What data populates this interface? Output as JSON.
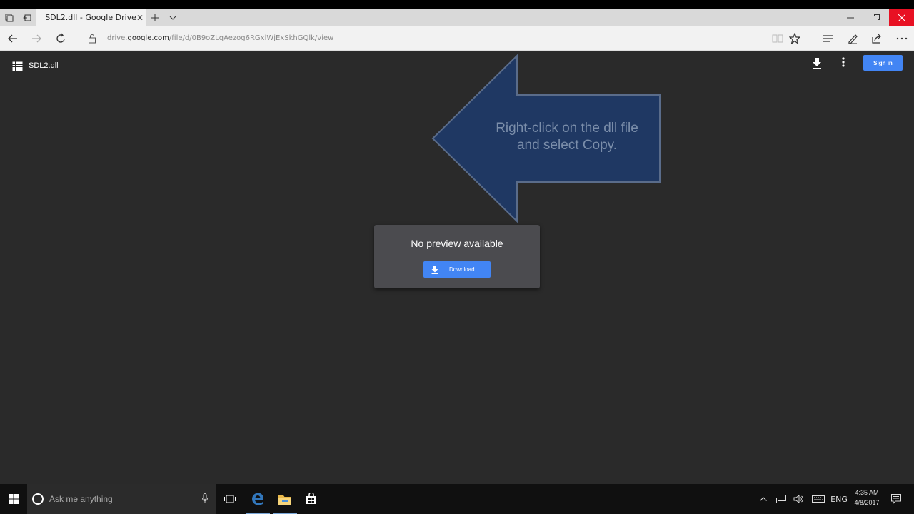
{
  "browser": {
    "tab_title": "SDL2.dll - Google Drive",
    "url_prefix": "drive.",
    "url_domain": "google.com",
    "url_path": "/file/d/0B9oZLqAezog6RGxlWjExSkhGQlk/view"
  },
  "viewer": {
    "file_name": "SDL2.dll",
    "sign_in_label": "Sign in",
    "arrow_callout_line1": "Right-click on the dll file",
    "arrow_callout_line2": "and select Copy.",
    "no_preview_title": "No preview available",
    "download_label": "Download"
  },
  "taskbar": {
    "search_placeholder": "Ask me anything",
    "language": "ENG",
    "time": "4:35 AM",
    "date": "4/8/2017"
  },
  "icons": [
    "tab-list-icon",
    "set-aside-icon",
    "google-drive-icon",
    "tab-close-icon",
    "new-tab-icon",
    "tab-dropdown-icon",
    "minimize-icon",
    "restore-icon",
    "close-icon",
    "back-icon",
    "forward-icon",
    "refresh-icon",
    "lock-icon",
    "reading-view-icon",
    "favorite-star-icon",
    "hub-icon",
    "web-note-icon",
    "share-icon",
    "more-icon",
    "file-icon",
    "download-icon",
    "more-vert-icon",
    "windows-start-icon",
    "cortana-icon",
    "microphone-icon",
    "task-view-icon",
    "edge-icon",
    "file-explorer-icon",
    "store-icon",
    "chevron-up-icon",
    "network-icon",
    "volume-icon",
    "keyboard-icon",
    "notification-icon"
  ],
  "colors": {
    "accent_blue": "#4285f4",
    "close_red": "#e81123",
    "viewer_bg": "#2a2a2a",
    "arrow_fill": "#1f3863"
  }
}
